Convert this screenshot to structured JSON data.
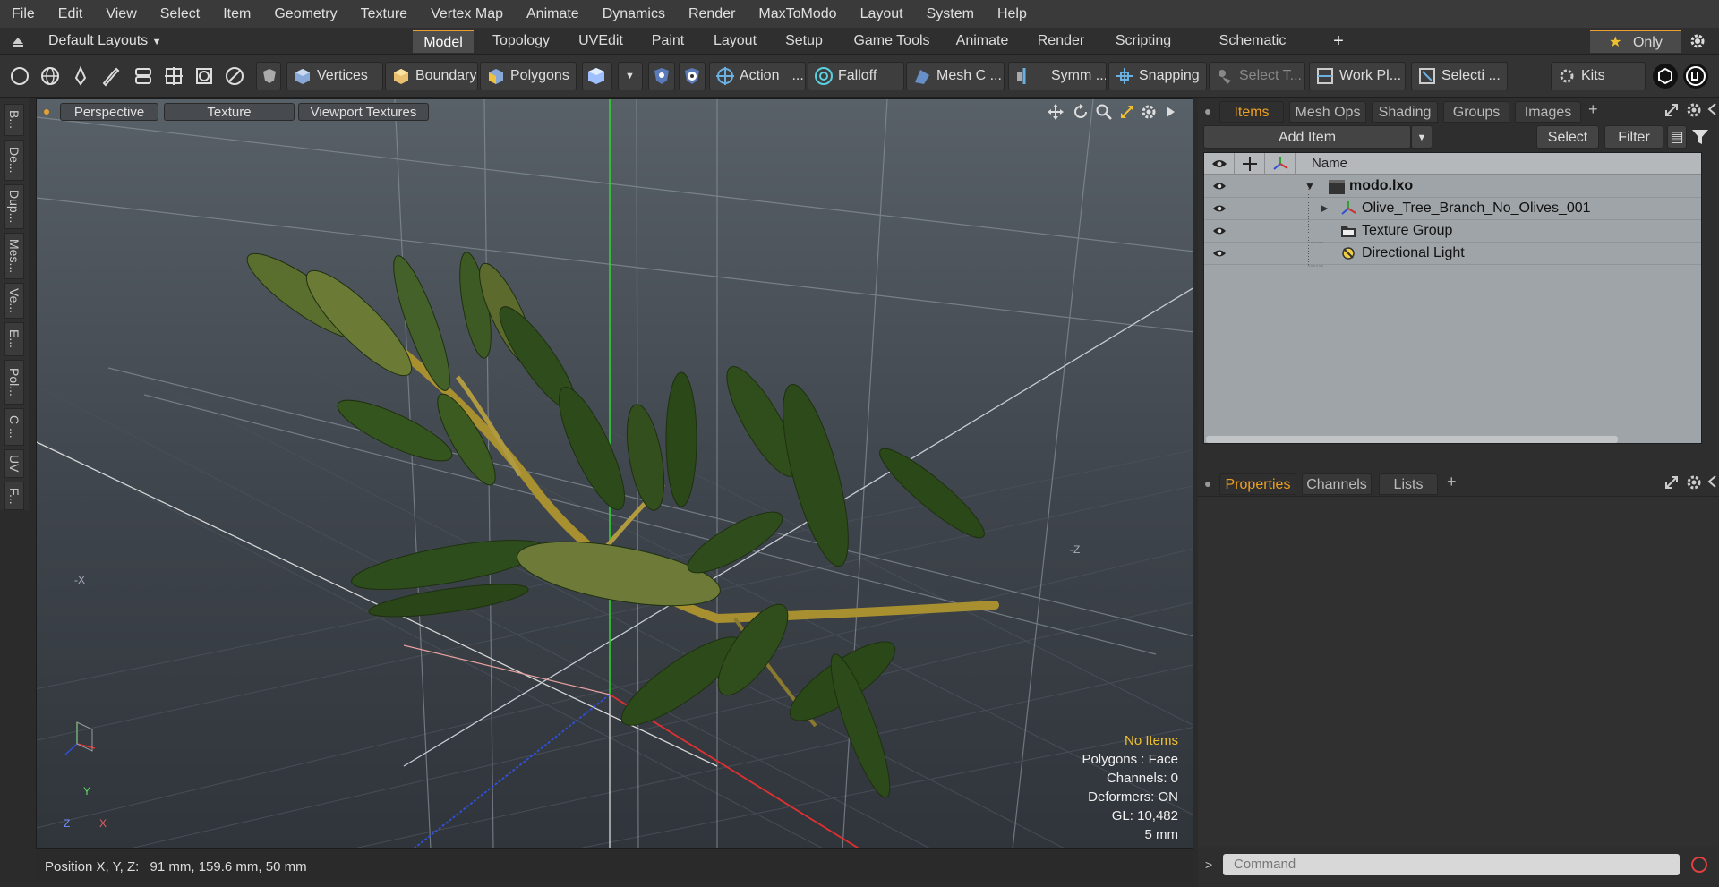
{
  "menu": [
    "File",
    "Edit",
    "View",
    "Select",
    "Item",
    "Geometry",
    "Texture",
    "Vertex Map",
    "Animate",
    "Dynamics",
    "Render",
    "MaxToModo",
    "Layout",
    "System",
    "Help"
  ],
  "layoutbar": {
    "layout_label": "Default Layouts",
    "tabs": [
      "Model",
      "Topology",
      "UVEdit",
      "Paint",
      "Layout",
      "Setup",
      "Game Tools",
      "Animate",
      "Render",
      "Scripting",
      "Schematic Fusion"
    ],
    "active_tab": "Model",
    "only_label": "Only"
  },
  "toolbar": {
    "vertices": "Vertices",
    "boundary": "Boundary",
    "polygons": "Polygons",
    "action": "Action",
    "falloff": "Falloff",
    "mesh": "Mesh C ...",
    "symm": "Symm ...",
    "snapping": "Snapping",
    "select_t": "Select T...",
    "work_pl": "Work Pl...",
    "selecti": "Selecti ...",
    "kits": "Kits"
  },
  "left_tabs": [
    "B...",
    "De...",
    "Dup...",
    "Mes...",
    "Ve...",
    "E...",
    "Pol...",
    "C ...",
    "UV",
    "F..."
  ],
  "viewport": {
    "tabs": [
      "Perspective",
      "Texture",
      "Viewport Textures"
    ],
    "info": {
      "no_items": "No Items",
      "polygons": "Polygons : Face",
      "channels": "Channels: 0",
      "deformers": "Deformers: ON",
      "gl": "GL: 10,482",
      "unit": "5 mm"
    },
    "axis_labels": {
      "y": "Y",
      "x": "X",
      "z": "Z",
      "neg_z": "-Z",
      "neg_x": "-X"
    }
  },
  "status": {
    "position_label": "Position X, Y, Z:",
    "position_value": "91 mm, 159.6 mm, 50 mm"
  },
  "items_panel": {
    "tabs": [
      "Items",
      "Mesh Ops",
      "Shading",
      "Groups",
      "Images"
    ],
    "active_tab": "Items",
    "add_item": "Add Item",
    "select": "Select",
    "filter": "Filter",
    "name_header": "Name",
    "rows": [
      {
        "name": "modo.lxo",
        "icon": "scene-icon"
      },
      {
        "name": "Olive_Tree_Branch_No_Olives_001",
        "icon": "mesh-locator-icon"
      },
      {
        "name": "Texture Group",
        "icon": "texture-group-icon"
      },
      {
        "name": "Directional Light",
        "icon": "light-icon"
      }
    ]
  },
  "properties_panel": {
    "tabs": [
      "Properties",
      "Channels",
      "Lists"
    ],
    "active_tab": "Properties",
    "command_placeholder": "Command"
  },
  "colors": {
    "accent": "#e8a030",
    "axis_x": "#e03030",
    "axis_y": "#30d030",
    "axis_z": "#3050e0"
  }
}
